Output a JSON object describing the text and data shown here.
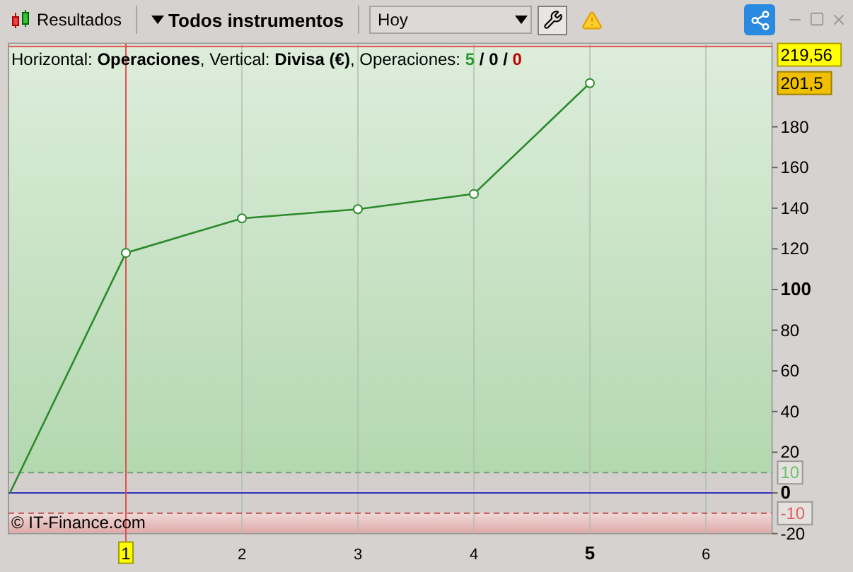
{
  "toolbar": {
    "results_button": "Resultados",
    "instruments_dropdown": "Todos instrumentos",
    "period_select": "Hoy"
  },
  "chart": {
    "legend": {
      "text": "Horizontal: **Operaciones**, Vertical: **Divisa (€)**, Operaciones:",
      "separator": "/",
      "counts": [
        {
          "value": "5",
          "color": "#2f9a2f"
        },
        {
          "value": "0",
          "color": "#000000"
        },
        {
          "value": "0",
          "color": "#c00000"
        }
      ]
    },
    "credit": "© IT-Finance.com",
    "badges": [
      {
        "label": "219,56",
        "kind": "high"
      },
      {
        "label": "201,5",
        "kind": "last"
      },
      {
        "label": "10",
        "kind": "upper"
      },
      {
        "label": "-10",
        "kind": "lower"
      }
    ],
    "chart_data": {
      "type": "line",
      "x": [
        0,
        1,
        2,
        3,
        4,
        5
      ],
      "series": [
        {
          "color": "#2a8a2a",
          "values": [
            0,
            118,
            135,
            139.5,
            147,
            201.5
          ],
          "marker": "o"
        }
      ],
      "xlim": [
        0,
        6.57
      ],
      "ylim": [
        -20,
        221
      ],
      "xticks": [
        1,
        2,
        3,
        4,
        5,
        6
      ],
      "yticks": [
        -20,
        0,
        20,
        40,
        60,
        80,
        100,
        120,
        140,
        160,
        180
      ],
      "grid": true,
      "ref_lines": [
        {
          "axis": "y",
          "value": 219.56,
          "color": "#e05050"
        },
        {
          "axis": "y",
          "value": 10,
          "color": "#70a070"
        },
        {
          "axis": "y",
          "value": 0,
          "color": "#3030c0"
        },
        {
          "axis": "y",
          "value": -10,
          "color": "#c05050"
        },
        {
          "axis": "x",
          "value": 1,
          "color": "#e05050"
        }
      ],
      "bands": [
        {
          "axis": "y",
          "from": 10,
          "to": 221,
          "color": "#b4d8b0"
        },
        {
          "axis": "y",
          "from": -20,
          "to": -10,
          "color": "#deaaa8"
        }
      ]
    }
  }
}
